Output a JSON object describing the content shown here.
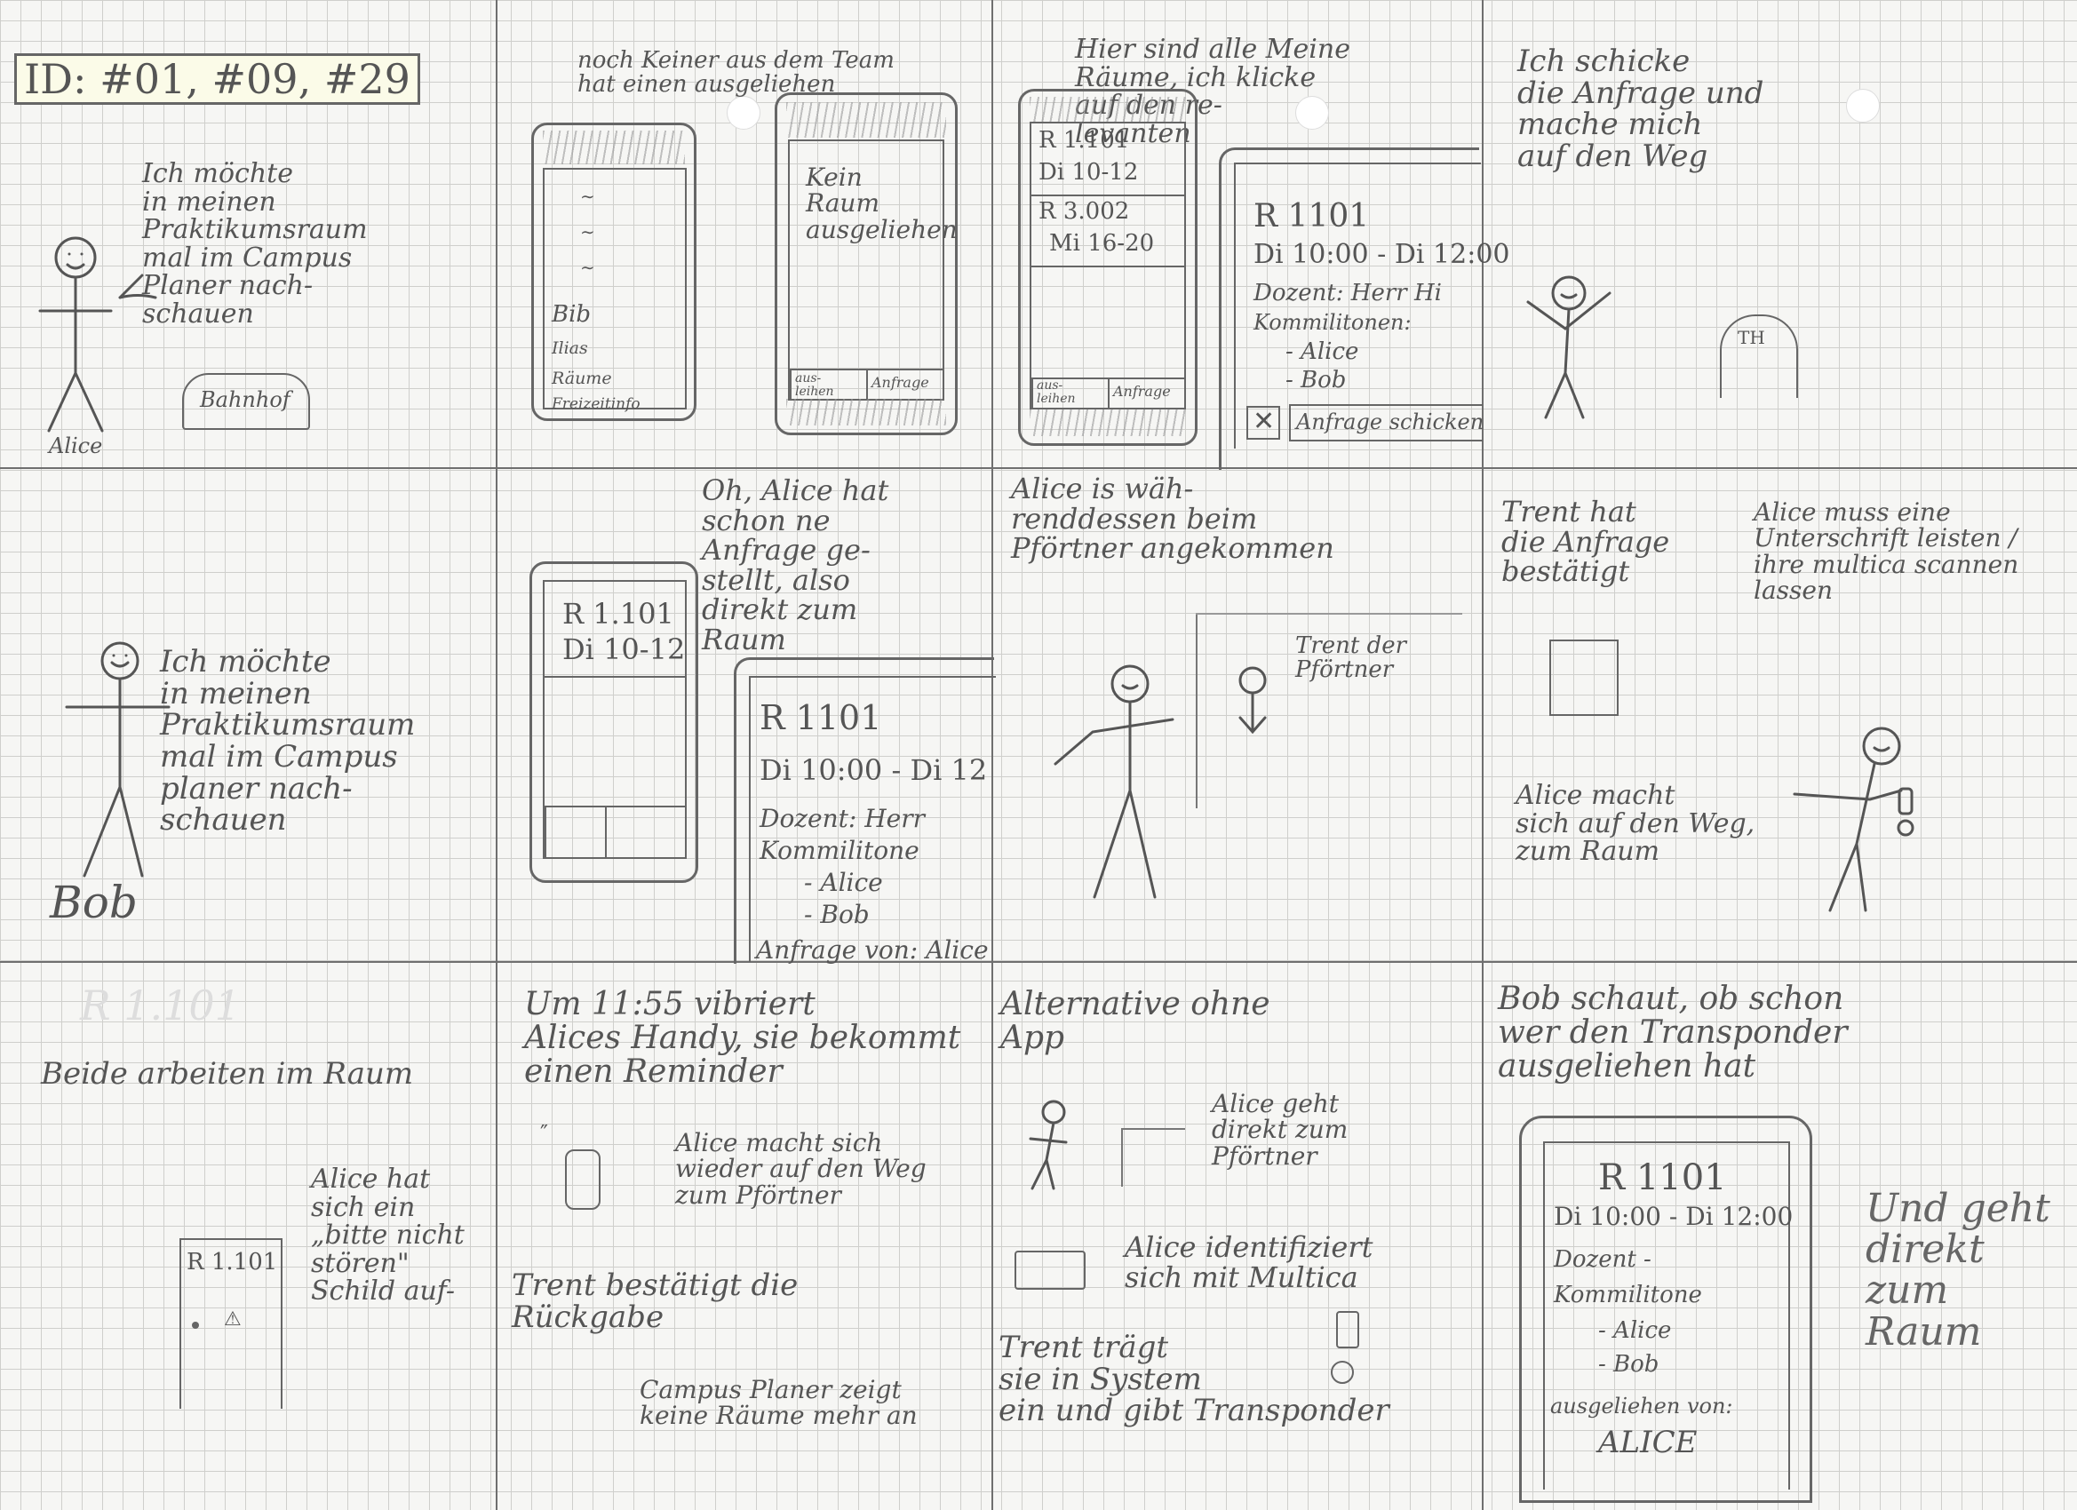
{
  "header": {
    "id_label": "ID: #01, #09, #29"
  },
  "panel1": {
    "speech": "Ich möchte\nin meinen\nPraktikumsraum\nmal im Campus\nPlaner nach-\nschauen",
    "name": "Alice",
    "sign": "Bahnhof"
  },
  "panel2": {
    "caption": "noch Keiner aus dem Team\nhat einen ausgeliehen",
    "menu": [
      "Bib",
      "Ilias",
      "Räume",
      "Freizeitinfo"
    ],
    "screen_text": "Kein\nRaum\nausgeliehen",
    "btn_left": "aus-\nleihen",
    "btn_right": "Anfrage"
  },
  "panel3": {
    "caption": "Hier sind alle Meine\nRäume, ich klicke\nauf den re-\nlevanten",
    "list": [
      "R 1.101",
      "Di 10-12",
      "R 3.002",
      "Mi 16-20"
    ],
    "btn_left": "aus-\nleihen",
    "btn_right": "Anfrage",
    "detail": [
      "R 1101",
      "Di 10:00 - Di 12:00",
      "Dozent: Herr Hi",
      "Kommilitonen:",
      "- Alice",
      "- Bob"
    ],
    "send_btn": "Anfrage schicken"
  },
  "panel4": {
    "caption": "Ich schicke\ndie Anfrage und\nmache mich\nauf den Weg",
    "badge": "TH"
  },
  "panel5": {
    "speech": "Ich möchte\nin meinen\nPraktikumsraum\nmal im Campus\nplaner nach-\nschauen",
    "name": "Bob"
  },
  "panel6": {
    "caption": "Oh, Alice hat\nschon ne\nAnfrage ge-\nstellt, also\ndirekt zum\nRaum",
    "screen": [
      "R 1.101",
      "Di 10-12"
    ],
    "detail": [
      "R 1101",
      "Di 10:00 - Di 12",
      "Dozent: Herr",
      "Kommilitone",
      "- Alice",
      "- Bob",
      "Anfrage von: Alice"
    ]
  },
  "panel7": {
    "caption": "Alice is wäh-\nrenddessen beim\nPförtner angekommen",
    "label": "Trent der\nPförtner"
  },
  "panel8": {
    "caption_left": "Trent hat\ndie Anfrage\nbestätigt",
    "caption_right": "Alice muss eine\nUnterschrift leisten /\nihre multica scannen\nlassen",
    "caption_bottom": "Alice macht\nsich auf den Weg,\nzum Raum"
  },
  "panel9": {
    "faded": "R 1.101",
    "caption": "Beide arbeiten im Raum",
    "note": "Alice hat\nsich ein\n„bitte nicht\nstören\"\nSchild auf-",
    "door": "R 1.101"
  },
  "panel10": {
    "caption": "Um 11:55 vibriert\nAlices Handy, sie bekommt\neinen Reminder",
    "note1": "Alice macht sich\nwieder auf den Weg\nzum Pförtner",
    "note2": "Trent bestätigt die\nRückgabe",
    "note3": "Campus Planer zeigt\nkeine Räume mehr an"
  },
  "panel11": {
    "caption": "Alternative ohne\nApp",
    "note1": "Alice geht\ndirekt zum\nPförtner",
    "note2": "Alice identifiziert\nsich mit Multica",
    "note3": "Trent trägt\nsie in System\nein und gibt Transponder"
  },
  "panel12": {
    "caption": "Bob schaut, ob schon\nwer den Transponder\nausgeliehen hat",
    "detail": [
      "R 1101",
      "Di 10:00 - Di 12:00",
      "Dozent -",
      "Kommilitone",
      "- Alice",
      "- Bob",
      "ausgeliehen von:",
      "ALICE"
    ],
    "note": "Und geht\ndirekt\nzum\nRaum"
  }
}
